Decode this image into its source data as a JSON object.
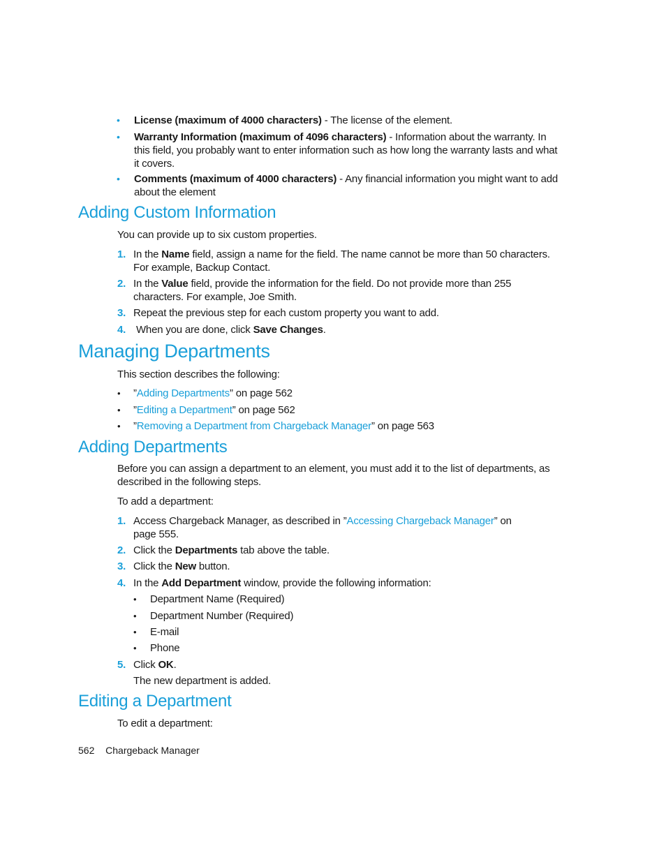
{
  "top_bullets": [
    {
      "bold": "License (maximum of 4000 characters)",
      "rest": " - The license of the element.",
      "line2": "",
      "line3": ""
    },
    {
      "bold": "Warranty Information (maximum of 4096 characters)",
      "rest": " - Information about the warranty. In",
      "line2": "this field, you probably want to enter information such as how long the warranty lasts and what",
      "line3": "it covers."
    },
    {
      "bold": "Comments (maximum of 4000 characters)",
      "rest": " - Any financial information you might want to add",
      "line2": "about the element",
      "line3": ""
    }
  ],
  "custom_info": {
    "heading": "Adding Custom Information",
    "intro": "You can provide up to six custom properties.",
    "steps": [
      {
        "num": "1.",
        "pre": "In the ",
        "bold": "Name",
        "post": " field, assign a name for the field. The name cannot be more than 50 characters.",
        "line2": "For example, Backup Contact."
      },
      {
        "num": "2.",
        "pre": "In the ",
        "bold": "Value",
        "post": " field, provide the information for the field. Do not provide more than 255",
        "line2": "characters. For example, Joe Smith."
      },
      {
        "num": "3.",
        "pre": "Repeat the previous step for each custom property you want to add.",
        "bold": "",
        "post": "",
        "line2": ""
      },
      {
        "num": "4.",
        "pre": " When you are done, click ",
        "bold": "Save Changes",
        "post": ".",
        "line2": ""
      }
    ]
  },
  "managing": {
    "heading": "Managing Departments",
    "intro": "This section describes the following:",
    "links": [
      {
        "open": "”",
        "link": "Adding Departments",
        "close": "” on page 562"
      },
      {
        "open": "”",
        "link": "Editing a Department",
        "close": "” on page 562"
      },
      {
        "open": "”",
        "link": "Removing a Department from Chargeback Manager",
        "close": "” on page 563"
      }
    ]
  },
  "adding": {
    "heading": "Adding Departments",
    "intro_line1": "Before you can assign a department to an element, you must add it to the list of departments, as",
    "intro_line2": "described in the following steps.",
    "lead": "To add a department:",
    "steps": [
      {
        "num": "1.",
        "pre": "Access Chargeback Manager, as described in ”",
        "link": "Accessing Chargeback Manager",
        "post": "” on",
        "line2": "page 555."
      },
      {
        "num": "2.",
        "pre": "Click the ",
        "bold": "Departments",
        "post": " tab above the table."
      },
      {
        "num": "3.",
        "pre": "Click the ",
        "bold": "New",
        "post": " button."
      },
      {
        "num": "4.",
        "pre": "In the ",
        "bold": "Add Department",
        "post": " window, provide the following information:"
      },
      {
        "num": "5.",
        "pre": "Click ",
        "bold": "OK",
        "post": "."
      }
    ],
    "sub_bullets": [
      "Department Name (Required)",
      "Department Number (Required)",
      "E-mail",
      "Phone"
    ],
    "result": "The new department is added."
  },
  "editing": {
    "heading": "Editing a Department",
    "intro": "To edit a department:"
  },
  "footer": {
    "page_number": "562",
    "title": "Chargeback Manager"
  },
  "glyphs": {
    "bullet": "•"
  },
  "colors": {
    "accent": "#1a9fd9",
    "text": "#1a1a1a"
  }
}
